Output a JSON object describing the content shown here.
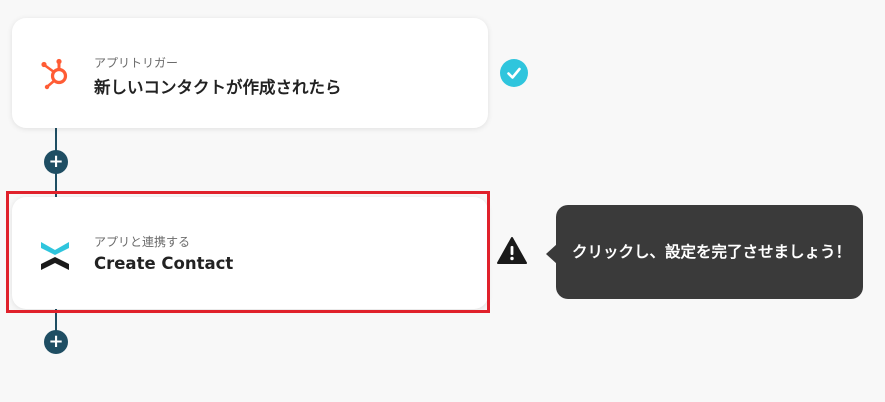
{
  "flow": {
    "steps": [
      {
        "subtitle": "アプリトリガー",
        "title": "新しいコンタクトが作成されたら",
        "icon": "hubspot-icon",
        "status": "completed",
        "status_icon": "check-icon",
        "status_color": "#2fc5dd"
      },
      {
        "subtitle": "アプリと連携する",
        "title": "Create Contact",
        "icon": "yoom-app-icon",
        "status": "warning",
        "status_icon": "warning-icon",
        "highlight_color": "#e0212b"
      }
    ],
    "add_button_label": "+",
    "tooltip": "クリックし、設定を完了させましょう！"
  },
  "colors": {
    "connector": "#1f4e63",
    "hubspot": "#ff5c35",
    "tooltip_bg": "#3a3a3a"
  }
}
